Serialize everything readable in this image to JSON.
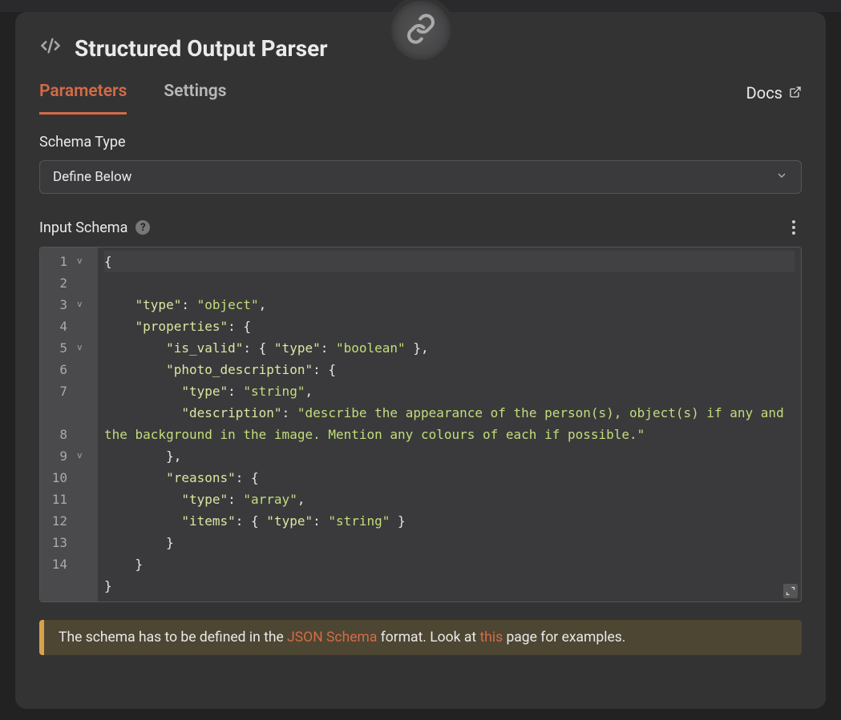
{
  "title": "Structured Output Parser",
  "tabs": {
    "parameters": "Parameters",
    "settings": "Settings",
    "docs": "Docs"
  },
  "fields": {
    "schema_type_label": "Schema Type",
    "schema_type_value": "Define Below",
    "input_schema_label": "Input Schema"
  },
  "editor": {
    "line_numbers": [
      "1",
      "2",
      "3",
      "4",
      "5",
      "6",
      "7",
      "8",
      "9",
      "10",
      "11",
      "12",
      "13",
      "14"
    ],
    "fold_rows": {
      "1": "v",
      "3": "v",
      "5": "v",
      "9": "v"
    },
    "tokens": [
      [
        [
          "{",
          "p"
        ]
      ],
      [
        [
          "    ",
          "p"
        ],
        [
          "\"type\"",
          "k"
        ],
        [
          ": ",
          "p"
        ],
        [
          "\"object\"",
          "s"
        ],
        [
          ",",
          "p"
        ]
      ],
      [
        [
          "    ",
          "p"
        ],
        [
          "\"properties\"",
          "k"
        ],
        [
          ": {",
          "p"
        ]
      ],
      [
        [
          "        ",
          "p"
        ],
        [
          "\"is_valid\"",
          "k"
        ],
        [
          ": { ",
          "p"
        ],
        [
          "\"type\"",
          "k"
        ],
        [
          ": ",
          "p"
        ],
        [
          "\"boolean\"",
          "s"
        ],
        [
          " },",
          "p"
        ]
      ],
      [
        [
          "        ",
          "p"
        ],
        [
          "\"photo_description\"",
          "k"
        ],
        [
          ": {",
          "p"
        ]
      ],
      [
        [
          "          ",
          "p"
        ],
        [
          "\"type\"",
          "k"
        ],
        [
          ": ",
          "p"
        ],
        [
          "\"string\"",
          "s"
        ],
        [
          ",",
          "p"
        ]
      ],
      [
        [
          "          ",
          "p"
        ],
        [
          "\"description\"",
          "k"
        ],
        [
          ": ",
          "p"
        ],
        [
          "\"describe the appearance of the person(s), object(s) if any and the background in the image. Mention any colours of each if possible.\"",
          "s"
        ]
      ],
      [
        [
          "        },",
          "p"
        ]
      ],
      [
        [
          "        ",
          "p"
        ],
        [
          "\"reasons\"",
          "k"
        ],
        [
          ": {",
          "p"
        ]
      ],
      [
        [
          "          ",
          "p"
        ],
        [
          "\"type\"",
          "k"
        ],
        [
          ": ",
          "p"
        ],
        [
          "\"array\"",
          "s"
        ],
        [
          ",",
          "p"
        ]
      ],
      [
        [
          "          ",
          "p"
        ],
        [
          "\"items\"",
          "k"
        ],
        [
          ": { ",
          "p"
        ],
        [
          "\"type\"",
          "k"
        ],
        [
          ": ",
          "p"
        ],
        [
          "\"string\"",
          "s"
        ],
        [
          " }",
          "p"
        ]
      ],
      [
        [
          "        }",
          "p"
        ]
      ],
      [
        [
          "    }",
          "p"
        ]
      ],
      [
        [
          "}",
          "p"
        ]
      ]
    ]
  },
  "tip": {
    "pre": "The schema has to be defined in the ",
    "link1": "JSON Schema",
    "mid": " format. Look at ",
    "link2": "this",
    "post": " page for examples."
  }
}
